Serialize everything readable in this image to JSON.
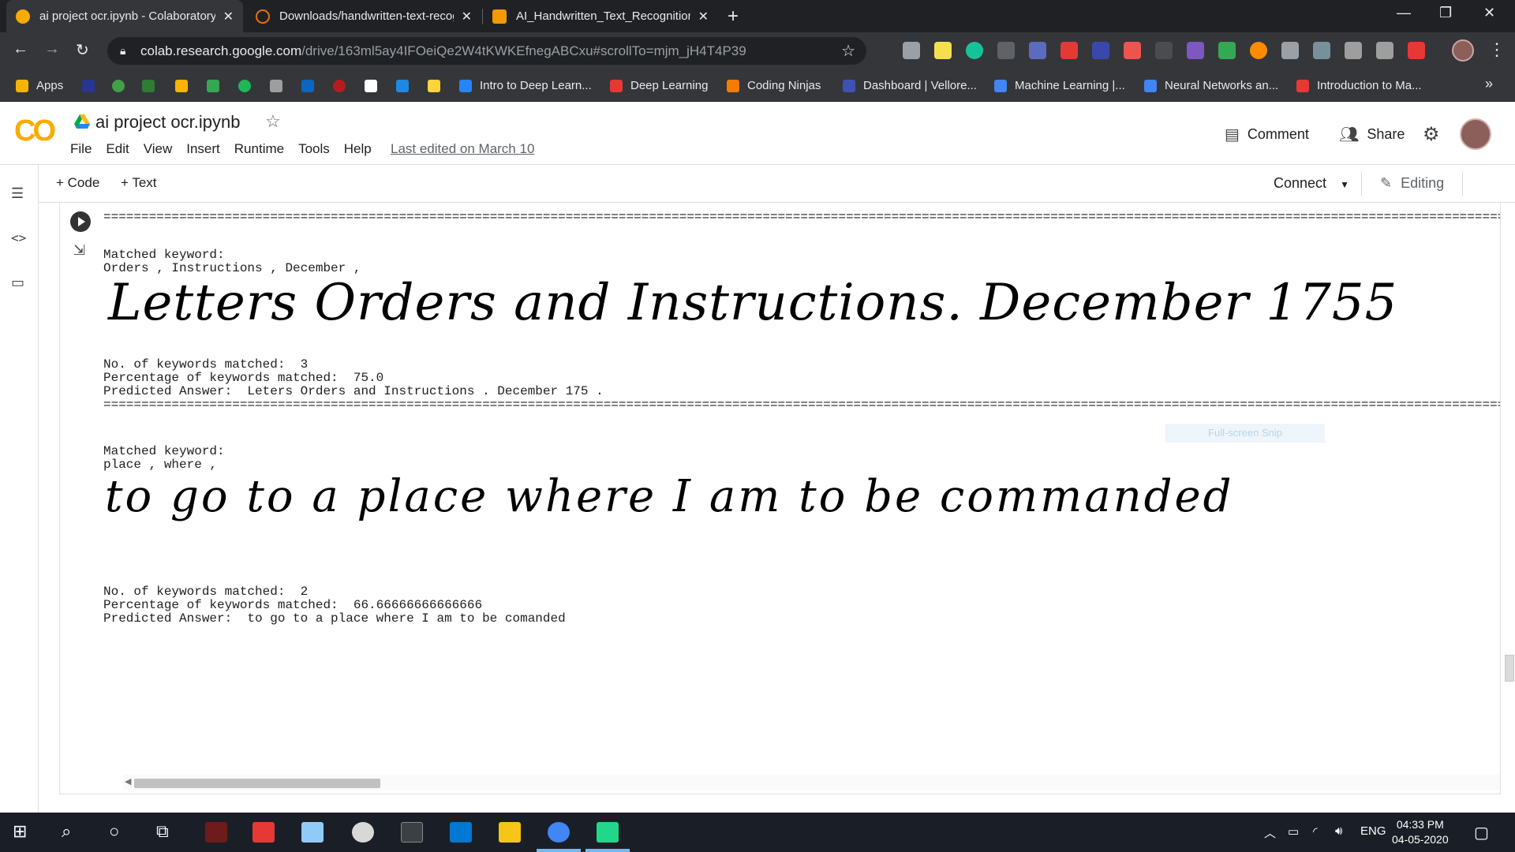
{
  "browser": {
    "tabs": [
      {
        "title": "ai project ocr.ipynb - Colaboratory",
        "active": true,
        "favicon_color": "#f9ab00"
      },
      {
        "title": "Downloads/handwritten-text-recognition",
        "active": false,
        "favicon_color": "#e8710a"
      },
      {
        "title": "AI_Handwritten_Text_Recognition",
        "active": false,
        "favicon_color": "#f29900"
      }
    ],
    "url_host": "colab.research.google.com",
    "url_path": "/drive/163ml5ay4IFOeiQe2W4tKWKEfnegABCxu#scrollTo=mjm_jH4T4P39",
    "bookmarks": [
      {
        "label": "Apps",
        "color": "#f4b400"
      },
      {
        "label": "Intro to Deep Learn...",
        "color": "#2684fc"
      },
      {
        "label": "Deep Learning",
        "color": "#e53935"
      },
      {
        "label": "Coding Ninjas",
        "color": "#f57c00"
      },
      {
        "label": "Dashboard | Vellore...",
        "color": "#3f51b5"
      },
      {
        "label": "Machine Learning |...",
        "color": "#4285f4"
      },
      {
        "label": "Neural Networks an...",
        "color": "#4285f4"
      },
      {
        "label": "Introduction to Ma...",
        "color": "#e53935"
      }
    ]
  },
  "colab": {
    "notebook_title": "ai project ocr.ipynb",
    "menu": [
      "File",
      "Edit",
      "View",
      "Insert",
      "Runtime",
      "Tools",
      "Help"
    ],
    "last_edited": "Last edited on March 10",
    "comment_label": "Comment",
    "share_label": "Share",
    "add_code_label": "+ Code",
    "add_text_label": "+ Text",
    "connect_label": "Connect",
    "editing_label": "Editing"
  },
  "output": {
    "separator": "================================================================================================================================================================================================================================================",
    "results": [
      {
        "matched_label": "Matched keyword:",
        "matched_keywords": "Orders , Instructions , December ,",
        "handwriting": "Letters Orders and Instructions. December 1755",
        "count_line": "No. of keywords matched:  3",
        "percent_line": "Percentage of keywords matched:  75.0",
        "predicted_line": "Predicted Answer:  Leters Orders and Instructions . December 175 ."
      },
      {
        "matched_label": "Matched keyword:",
        "matched_keywords": "place , where ,",
        "handwriting": "to go to a place where I am to be commanded",
        "count_line": "No. of keywords matched:  2",
        "percent_line": "Percentage of keywords matched:  66.66666666666666",
        "predicted_line": "Predicted Answer:  to go to a place where I am to be comanded"
      }
    ],
    "snip_hint": "Full-screen Snip"
  },
  "taskbar": {
    "language": "ENG",
    "time": "04:33 PM",
    "date": "04-05-2020"
  }
}
